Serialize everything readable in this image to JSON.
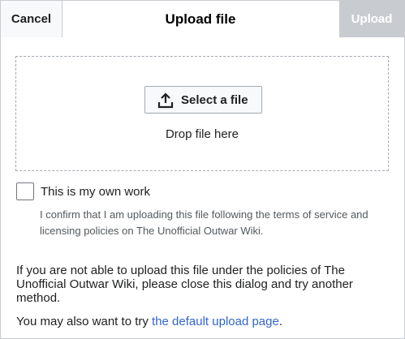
{
  "header": {
    "cancel_label": "Cancel",
    "title": "Upload file",
    "upload_label": "Upload"
  },
  "dropzone": {
    "select_label": "Select a file",
    "drop_text": "Drop file here",
    "icon": "upload-icon"
  },
  "own_work": {
    "label": "This is my own work",
    "checked": false,
    "confirm_text": "I confirm that I am uploading this file following the terms of service and licensing policies on The Unofficial Outwar Wiki."
  },
  "footer": {
    "policy_text": "If you are not able to upload this file under the policies of The Unofficial Outwar Wiki, please close this dialog and try another method.",
    "try_prefix": "You may also want to try ",
    "try_link": "the default upload page",
    "try_suffix": "."
  },
  "colors": {
    "link": "#3366cc",
    "disabled_button": "#c8ccd1"
  }
}
